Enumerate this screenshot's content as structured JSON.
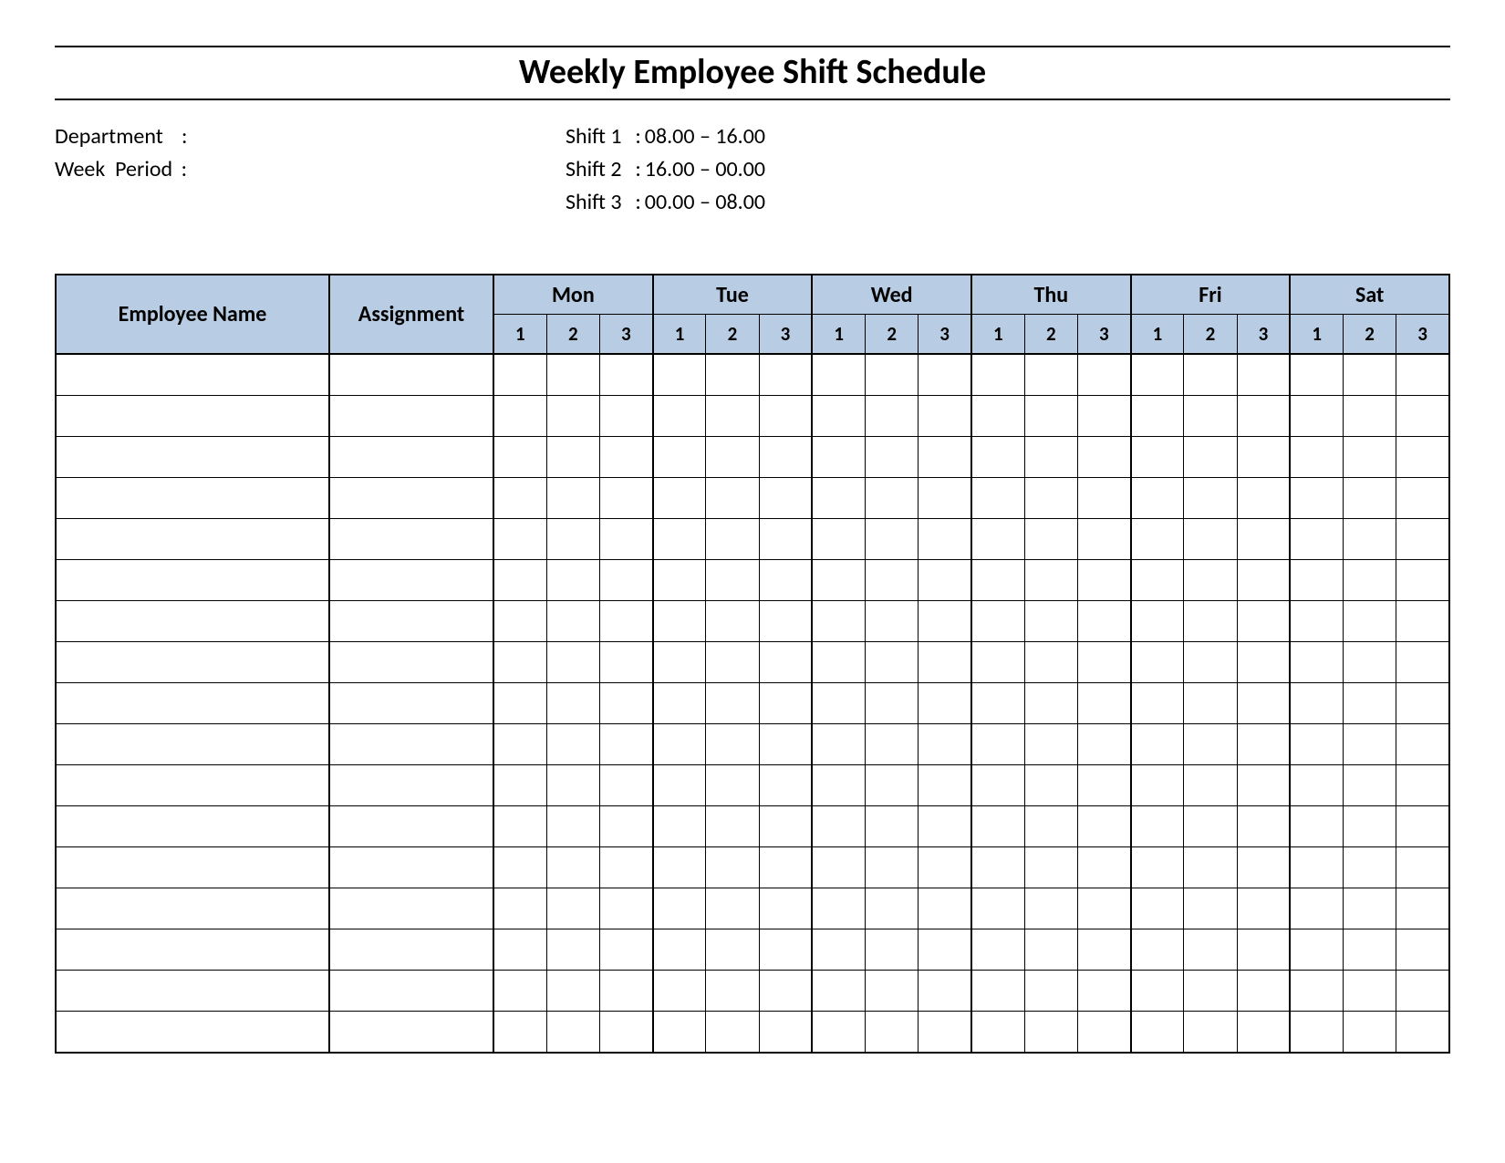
{
  "title": "Weekly Employee Shift Schedule",
  "meta": {
    "department_label": "Department",
    "department_value": "",
    "week_period_label": "Week  Period",
    "week_period_value": "",
    "shift1_label": "Shift 1",
    "shift1_value": "08.00  – 16.00",
    "shift2_label": "Shift 2",
    "shift2_value": "16.00  – 00.00",
    "shift3_label": "Shift 3",
    "shift3_value": "00.00  – 08.00"
  },
  "columns": {
    "employee_name": "Employee Name",
    "assignment": "Assignment",
    "days": [
      "Mon",
      "Tue",
      "Wed",
      "Thu",
      "Fri",
      "Sat"
    ],
    "shifts": [
      "1",
      "2",
      "3"
    ]
  },
  "row_count": 17,
  "colors": {
    "header_bg": "#b8cce4"
  }
}
